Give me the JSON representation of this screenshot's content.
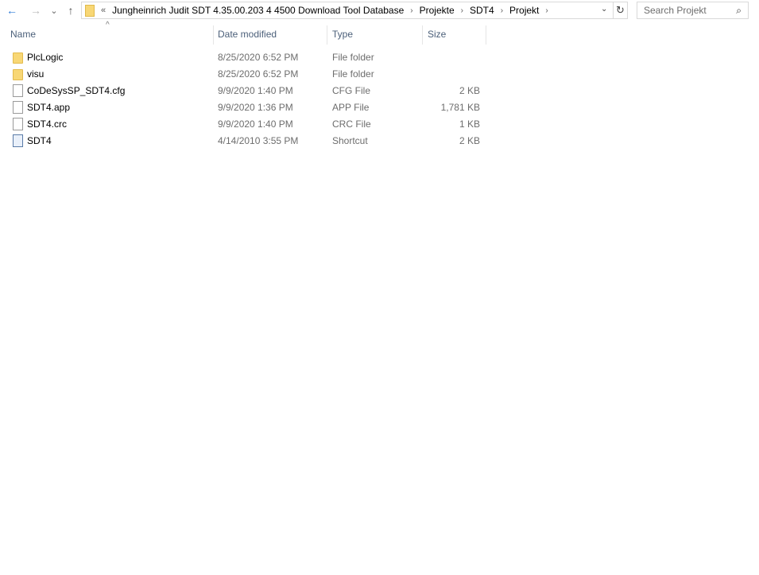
{
  "nav": {
    "back": "←",
    "forward": "→",
    "recent": "⌄",
    "up": "↑"
  },
  "address": {
    "overflow": "«",
    "crumbs": [
      "Jungheinrich Judit SDT 4.35.00.203 4 4500 Download Tool Database",
      "Projekte",
      "SDT4",
      "Projekt"
    ]
  },
  "search": {
    "placeholder": "Search Projekt"
  },
  "columns": {
    "name": "Name",
    "date": "Date modified",
    "type": "Type",
    "size": "Size"
  },
  "files": [
    {
      "name": "PlcLogic",
      "date": "8/25/2020 6:52 PM",
      "type": "File folder",
      "size": "",
      "icon": "folder"
    },
    {
      "name": "visu",
      "date": "8/25/2020 6:52 PM",
      "type": "File folder",
      "size": "",
      "icon": "folder"
    },
    {
      "name": "CoDeSysSP_SDT4.cfg",
      "date": "9/9/2020 1:40 PM",
      "type": "CFG File",
      "size": "2 KB",
      "icon": "file"
    },
    {
      "name": "SDT4.app",
      "date": "9/9/2020 1:36 PM",
      "type": "APP File",
      "size": "1,781 KB",
      "icon": "file"
    },
    {
      "name": "SDT4.crc",
      "date": "9/9/2020 1:40 PM",
      "type": "CRC File",
      "size": "1 KB",
      "icon": "file"
    },
    {
      "name": "SDT4",
      "date": "4/14/2010 3:55 PM",
      "type": "Shortcut",
      "size": "2 KB",
      "icon": "shortcut"
    }
  ]
}
